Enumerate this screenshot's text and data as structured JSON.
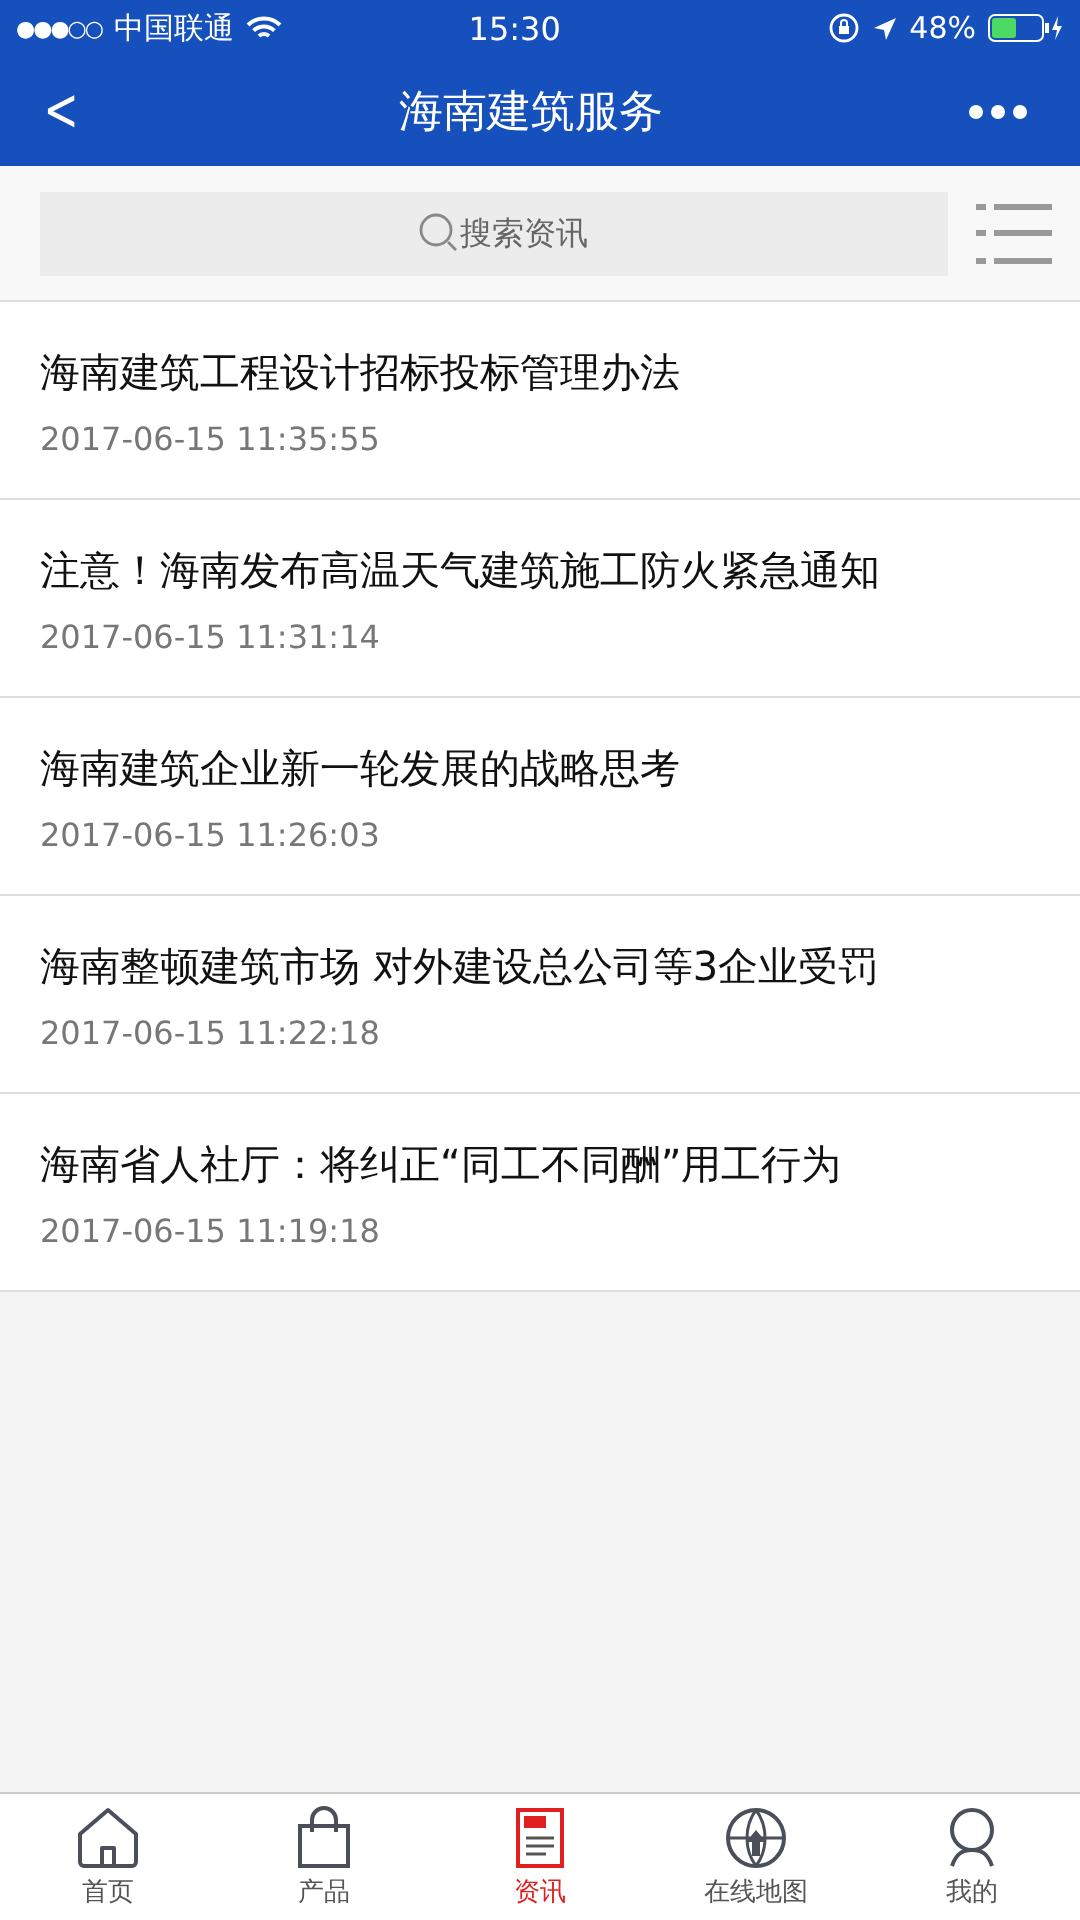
{
  "status_bar": {
    "signal": "●●●○○",
    "carrier": "中国联通",
    "time": "15:30",
    "battery": "48%"
  },
  "nav_bar": {
    "back": "<",
    "title": "海南建筑服务"
  },
  "search": {
    "placeholder": "搜索资讯"
  },
  "news": [
    {
      "title": "海南建筑工程设计招标投标管理办法",
      "date": "2017-06-15 11:35:55"
    },
    {
      "title": "注意！海南发布高温天气建筑施工防火紧急通知",
      "date": "2017-06-15 11:31:14"
    },
    {
      "title": "海南建筑企业新一轮发展的战略思考",
      "date": "2017-06-15 11:26:03"
    },
    {
      "title": "海南整顿建筑市场 对外建设总公司等3企业受罚",
      "date": "2017-06-15 11:22:18"
    },
    {
      "title": "海南省人社厅：将纠正“同工不同酬”用工行为",
      "date": "2017-06-15 11:19:18"
    }
  ],
  "tab_bar": [
    {
      "kind": "home",
      "label": "首页",
      "selected": false
    },
    {
      "kind": "bag",
      "label": "产品",
      "selected": false
    },
    {
      "kind": "news",
      "label": "资讯",
      "selected": true
    },
    {
      "kind": "globe",
      "label": "在线地图",
      "selected": false
    },
    {
      "kind": "person",
      "label": "我的",
      "selected": false
    }
  ]
}
